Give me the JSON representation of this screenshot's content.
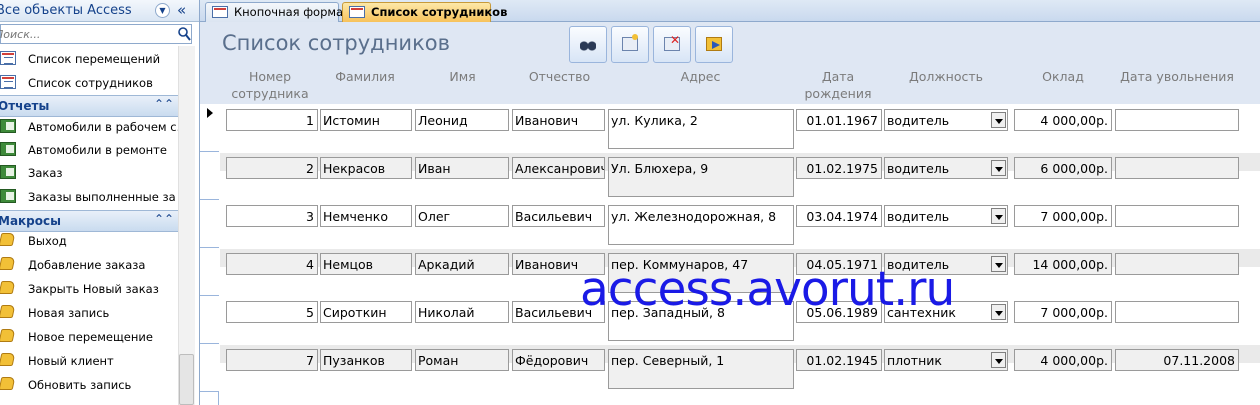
{
  "nav": {
    "title": "Все объекты Access",
    "search_placeholder": "Поиск...",
    "forms": [
      "Список перемещений",
      "Список сотрудников"
    ],
    "reports_group": "Отчеты",
    "reports": [
      "Автомобили в рабочем с...",
      "Автомобили в ремонте",
      "Заказ",
      "Заказы выполненные за ..."
    ],
    "macros_group": "Макросы",
    "macros": [
      "Выход",
      "Добавление заказа",
      "Закрыть Новый заказ",
      "Новая запись",
      "Новое перемещение",
      "Новый клиент",
      "Обновить запись"
    ]
  },
  "tabs": [
    "Кнопочная форма",
    "Список сотрудников"
  ],
  "form": {
    "title": "Список сотрудников",
    "buttons": [
      "find-binoculars-icon",
      "new-record-icon",
      "delete-record-icon",
      "exit-form-icon"
    ],
    "headers": {
      "num": "Номер сотрудника",
      "last": "Фамилия",
      "first": "Имя",
      "patr": "Отчество",
      "addr": "Адрес",
      "dob": "Дата рождения",
      "pos": "Должность",
      "salary": "Оклад",
      "fired": "Дата увольнения"
    },
    "rows": [
      {
        "num": "1",
        "last": "Истомин",
        "first": "Леонид",
        "patr": "Иванович",
        "addr": "ул. Кулика, 2",
        "dob": "01.01.1967",
        "pos": "водитель",
        "salary": "4 000,00р.",
        "fired": ""
      },
      {
        "num": "2",
        "last": "Некрасов",
        "first": "Иван",
        "patr": "Алексанрович",
        "addr": "Ул. Блюхера, 9",
        "dob": "01.02.1975",
        "pos": "водитель",
        "salary": "6 000,00р.",
        "fired": ""
      },
      {
        "num": "3",
        "last": "Немченко",
        "first": "Олег",
        "patr": "Васильевич",
        "addr": "ул. Железнодорожная, 8",
        "dob": "03.04.1974",
        "pos": "водитель",
        "salary": "7 000,00р.",
        "fired": ""
      },
      {
        "num": "4",
        "last": "Немцов",
        "first": "Аркадий",
        "patr": "Иванович",
        "addr": "пер. Коммунаров, 47",
        "dob": "04.05.1971",
        "pos": "водитель",
        "salary": "14 000,00р.",
        "fired": ""
      },
      {
        "num": "5",
        "last": "Сироткин",
        "first": "Николай",
        "patr": "Васильевич",
        "addr": "пер. Западный, 8",
        "dob": "05.06.1989",
        "pos": "сантехник",
        "salary": "7 000,00р.",
        "fired": ""
      },
      {
        "num": "7",
        "last": "Пузанков",
        "first": "Роман",
        "patr": "Фёдорович",
        "addr": "пер. Северный, 1",
        "dob": "01.02.1945",
        "pos": "плотник",
        "salary": "4 000,00р.",
        "fired": "07.11.2008"
      }
    ]
  },
  "watermark": "access.avorut.ru"
}
